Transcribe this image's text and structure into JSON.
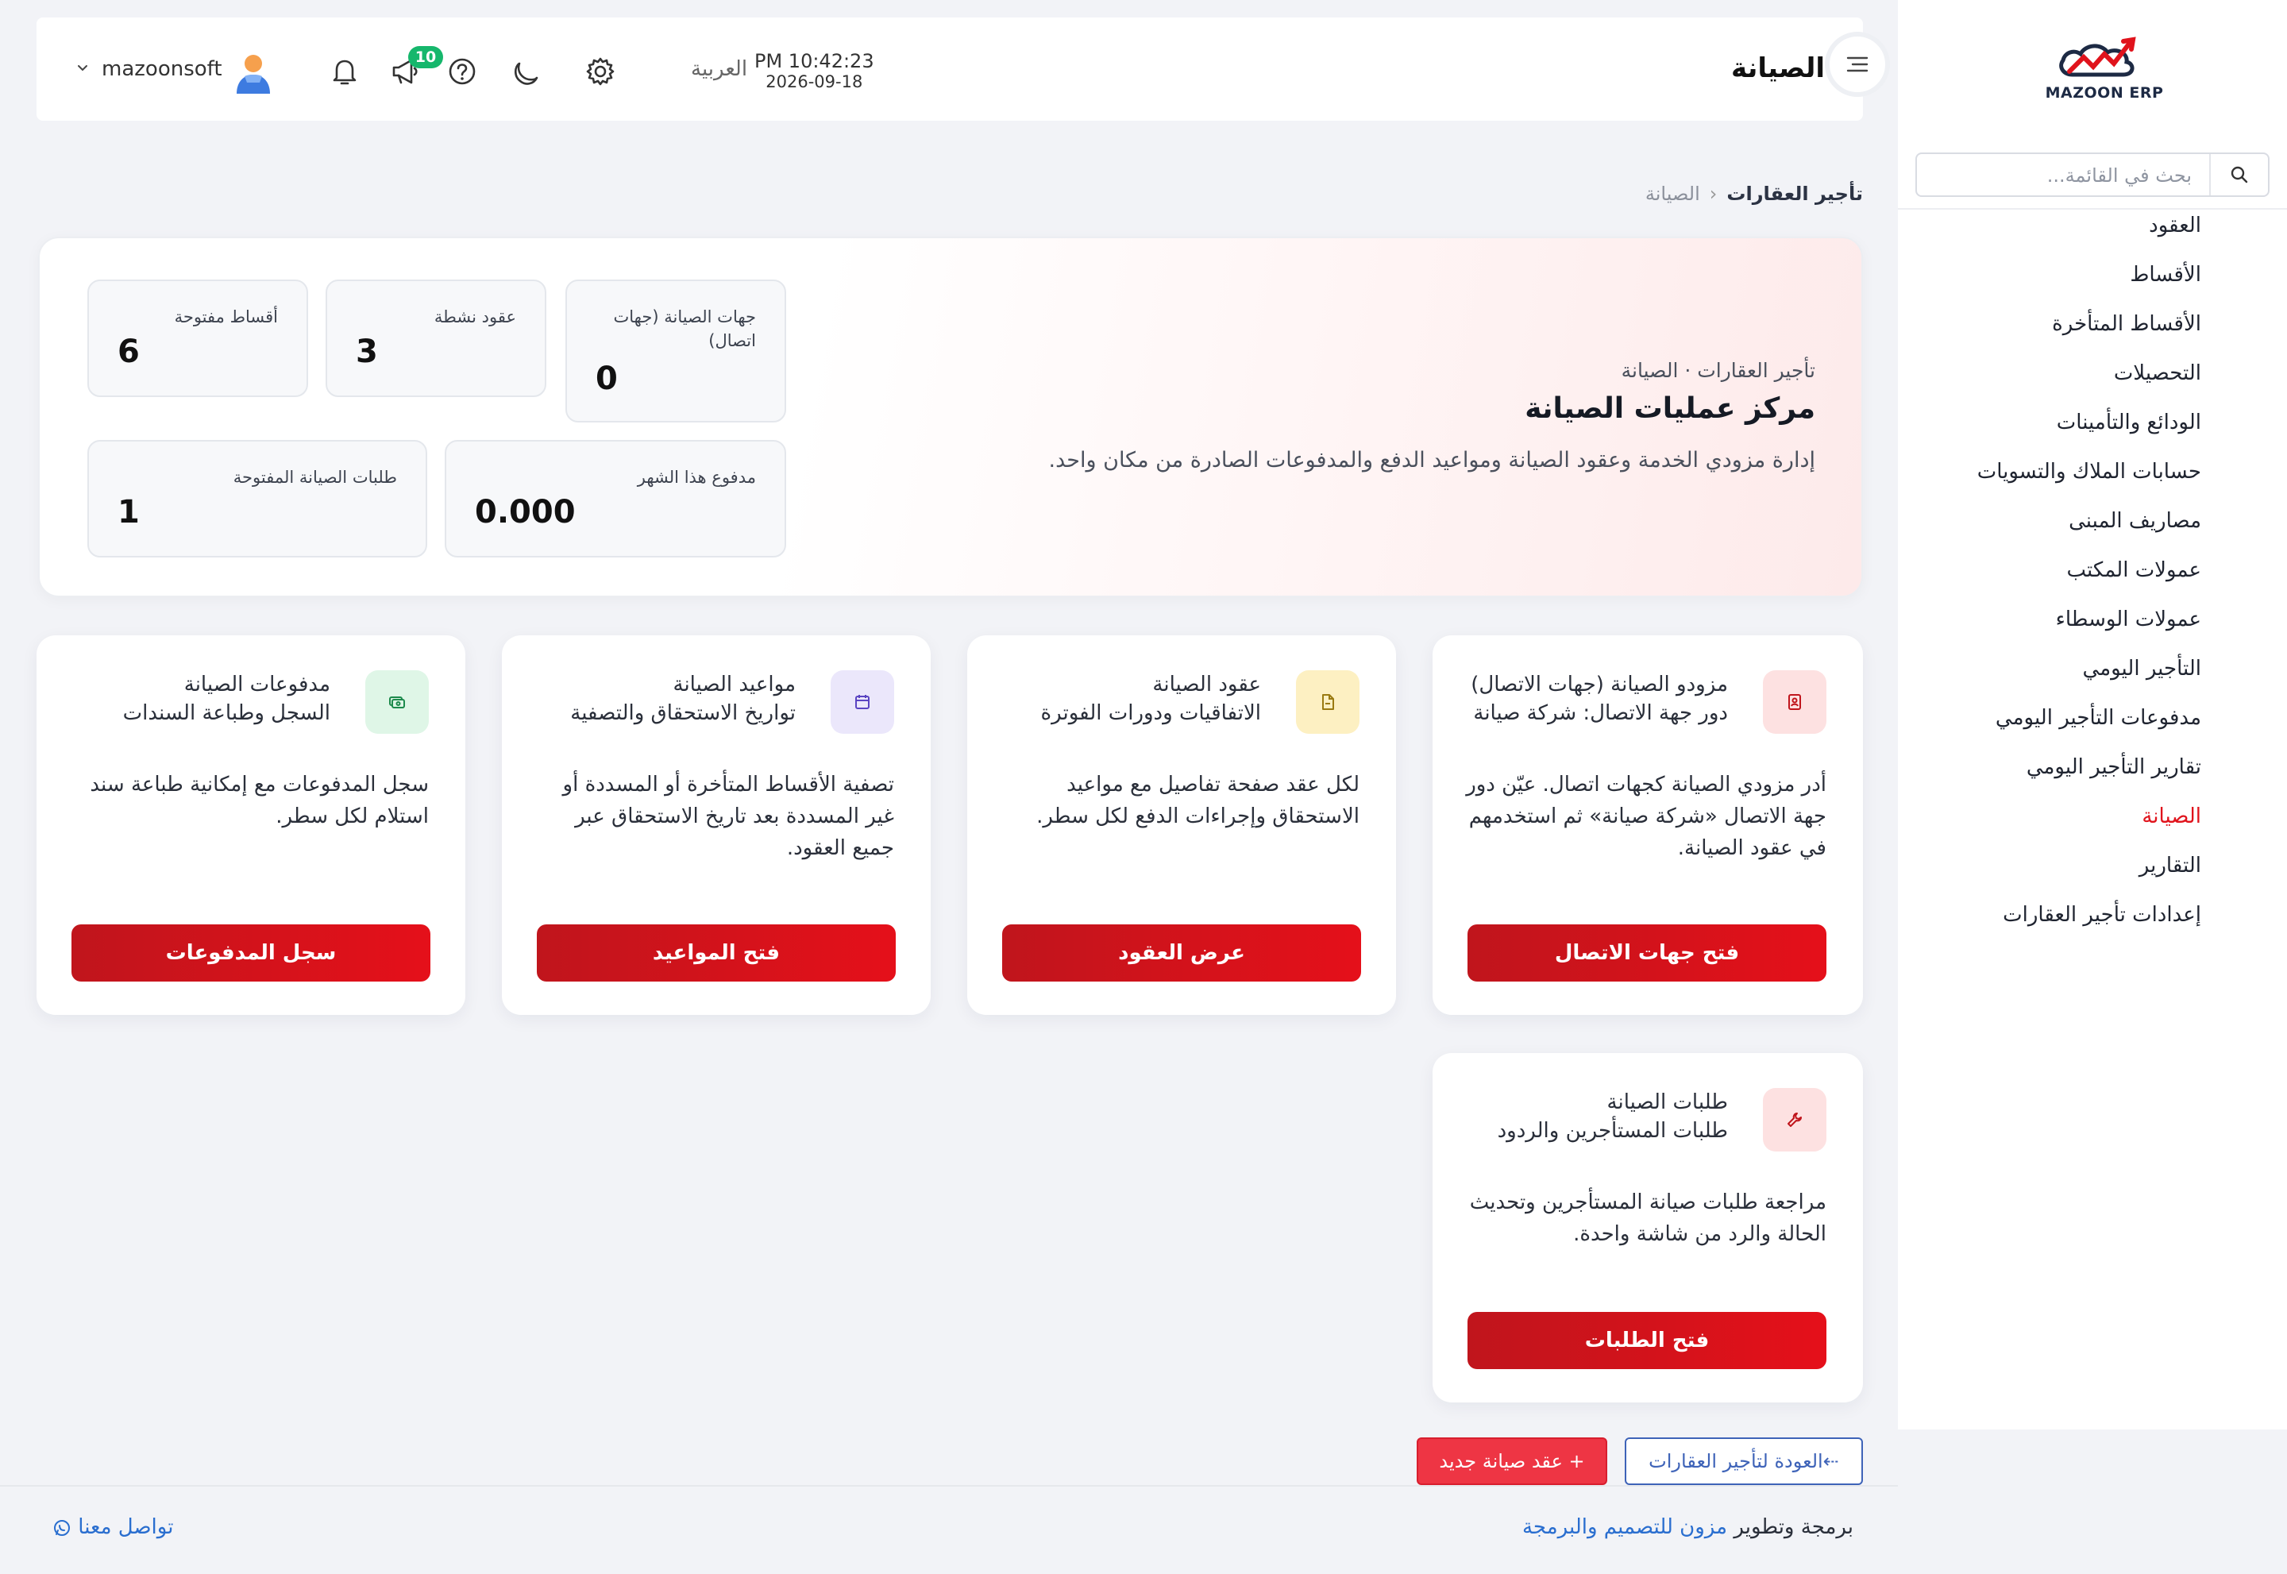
{
  "app": {
    "logo_text": "MAZOON ERP",
    "page_title": "الصيانة"
  },
  "header": {
    "time": "PM 10:42:23",
    "date": "2026-09-18",
    "language": "العربية",
    "notification_count": "10",
    "username": "mazoonsoft"
  },
  "sidebar": {
    "search_placeholder": "بحث في القائمة...",
    "items": [
      {
        "label": "العقود"
      },
      {
        "label": "الأقساط"
      },
      {
        "label": "الأقساط المتأخرة"
      },
      {
        "label": "التحصيلات"
      },
      {
        "label": "الودائع والتأمينات"
      },
      {
        "label": "حسابات الملاك والتسويات"
      },
      {
        "label": "مصاريف المبنى"
      },
      {
        "label": "عمولات المكتب"
      },
      {
        "label": "عمولات الوسطاء"
      },
      {
        "label": "التأجير اليومي"
      },
      {
        "label": "مدفوعات التأجير اليومي"
      },
      {
        "label": "تقارير التأجير اليومي"
      },
      {
        "label": "الصيانة",
        "active": true
      },
      {
        "label": "التقارير"
      },
      {
        "label": "إعدادات تأجير العقارات"
      }
    ]
  },
  "breadcrumb": {
    "root": "تأجير العقارات",
    "separator": "‹",
    "current": "الصيانة"
  },
  "hero": {
    "subtitle": "تأجير العقارات · الصيانة",
    "title": "مركز عمليات الصيانة",
    "description": "إدارة مزودي الخدمة وعقود الصيانة ومواعيد الدفع والمدفوعات الصادرة من مكان واحد.",
    "stats": {
      "providers": {
        "label": "جهات الصيانة (جهات اتصال)",
        "value": "0"
      },
      "active_contracts": {
        "label": "عقود نشطة",
        "value": "3"
      },
      "open_installments": {
        "label": "أقساط مفتوحة",
        "value": "6"
      },
      "paid_this_month": {
        "label": "مدفوع هذا الشهر",
        "value": "0.000"
      },
      "open_requests": {
        "label": "طلبات الصيانة المفتوحة",
        "value": "1"
      }
    }
  },
  "cards": {
    "providers": {
      "title": "مزودو الصيانة (جهات الاتصال)",
      "subtitle": "دور جهة الاتصال: شركة صيانة",
      "description": "أدر مزودي الصيانة كجهات اتصال. عيّن دور جهة الاتصال «شركة صيانة» ثم استخدمهم في عقود الصيانة.",
      "button": "فتح جهات الاتصال",
      "icon": "contact-card-icon",
      "color": "#fde1e1"
    },
    "contracts": {
      "title": "عقود الصيانة",
      "subtitle": "الاتفاقيات ودورات الفوترة",
      "description": "لكل عقد صفحة تفاصيل مع مواعيد الاستحقاق وإجراءات الدفع لكل سطر.",
      "button": "عرض العقود",
      "icon": "document-icon",
      "color": "#fdf0c2"
    },
    "schedule": {
      "title": "مواعيد الصيانة",
      "subtitle": "تواريخ الاستحقاق والتصفية",
      "description": "تصفية الأقساط المتأخرة أو المسددة أو غير المسددة بعد تاريخ الاستحقاق عبر جميع العقود.",
      "button": "فتح المواعيد",
      "icon": "calendar-icon",
      "color": "#ebe7fb"
    },
    "payments": {
      "title": "مدفوعات الصيانة",
      "subtitle": "السجل وطباعة السندات",
      "description": "سجل المدفوعات مع إمكانية طباعة سند استلام لكل سطر.",
      "button": "سجل المدفوعات",
      "icon": "money-icon",
      "color": "#dff6e7"
    },
    "requests": {
      "title": "طلبات الصيانة",
      "subtitle": "طلبات المستأجرين والردود",
      "description": "مراجعة طلبات صيانة المستأجرين وتحديث الحالة والرد من شاشة واحدة.",
      "button": "فتح الطلبات",
      "icon": "wrench-icon",
      "color": "#fde1e1"
    }
  },
  "actions": {
    "new_contract": "+ عقد صيانة جديد",
    "back": "⇠العودة لتأجير العقارات"
  },
  "footer": {
    "credit_prefix": "برمجة وتطوير ",
    "credit_link": "مزون للتصميم والبرمجة",
    "contact": "تواصل معنا"
  },
  "colors": {
    "accent_red": "#e0131c",
    "badge_green": "#16b76c",
    "link_blue": "#2a6ecf"
  }
}
